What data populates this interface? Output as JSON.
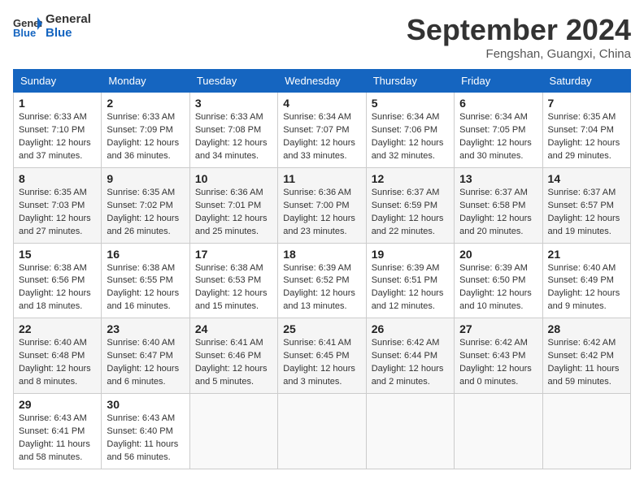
{
  "header": {
    "logo_general": "General",
    "logo_blue": "Blue",
    "month_title": "September 2024",
    "location": "Fengshan, Guangxi, China"
  },
  "weekdays": [
    "Sunday",
    "Monday",
    "Tuesday",
    "Wednesday",
    "Thursday",
    "Friday",
    "Saturday"
  ],
  "weeks": [
    [
      {
        "day": "1",
        "sunrise": "6:33 AM",
        "sunset": "7:10 PM",
        "daylight": "12 hours and 37 minutes."
      },
      {
        "day": "2",
        "sunrise": "6:33 AM",
        "sunset": "7:09 PM",
        "daylight": "12 hours and 36 minutes."
      },
      {
        "day": "3",
        "sunrise": "6:33 AM",
        "sunset": "7:08 PM",
        "daylight": "12 hours and 34 minutes."
      },
      {
        "day": "4",
        "sunrise": "6:34 AM",
        "sunset": "7:07 PM",
        "daylight": "12 hours and 33 minutes."
      },
      {
        "day": "5",
        "sunrise": "6:34 AM",
        "sunset": "7:06 PM",
        "daylight": "12 hours and 32 minutes."
      },
      {
        "day": "6",
        "sunrise": "6:34 AM",
        "sunset": "7:05 PM",
        "daylight": "12 hours and 30 minutes."
      },
      {
        "day": "7",
        "sunrise": "6:35 AM",
        "sunset": "7:04 PM",
        "daylight": "12 hours and 29 minutes."
      }
    ],
    [
      {
        "day": "8",
        "sunrise": "6:35 AM",
        "sunset": "7:03 PM",
        "daylight": "12 hours and 27 minutes."
      },
      {
        "day": "9",
        "sunrise": "6:35 AM",
        "sunset": "7:02 PM",
        "daylight": "12 hours and 26 minutes."
      },
      {
        "day": "10",
        "sunrise": "6:36 AM",
        "sunset": "7:01 PM",
        "daylight": "12 hours and 25 minutes."
      },
      {
        "day": "11",
        "sunrise": "6:36 AM",
        "sunset": "7:00 PM",
        "daylight": "12 hours and 23 minutes."
      },
      {
        "day": "12",
        "sunrise": "6:37 AM",
        "sunset": "6:59 PM",
        "daylight": "12 hours and 22 minutes."
      },
      {
        "day": "13",
        "sunrise": "6:37 AM",
        "sunset": "6:58 PM",
        "daylight": "12 hours and 20 minutes."
      },
      {
        "day": "14",
        "sunrise": "6:37 AM",
        "sunset": "6:57 PM",
        "daylight": "12 hours and 19 minutes."
      }
    ],
    [
      {
        "day": "15",
        "sunrise": "6:38 AM",
        "sunset": "6:56 PM",
        "daylight": "12 hours and 18 minutes."
      },
      {
        "day": "16",
        "sunrise": "6:38 AM",
        "sunset": "6:55 PM",
        "daylight": "12 hours and 16 minutes."
      },
      {
        "day": "17",
        "sunrise": "6:38 AM",
        "sunset": "6:53 PM",
        "daylight": "12 hours and 15 minutes."
      },
      {
        "day": "18",
        "sunrise": "6:39 AM",
        "sunset": "6:52 PM",
        "daylight": "12 hours and 13 minutes."
      },
      {
        "day": "19",
        "sunrise": "6:39 AM",
        "sunset": "6:51 PM",
        "daylight": "12 hours and 12 minutes."
      },
      {
        "day": "20",
        "sunrise": "6:39 AM",
        "sunset": "6:50 PM",
        "daylight": "12 hours and 10 minutes."
      },
      {
        "day": "21",
        "sunrise": "6:40 AM",
        "sunset": "6:49 PM",
        "daylight": "12 hours and 9 minutes."
      }
    ],
    [
      {
        "day": "22",
        "sunrise": "6:40 AM",
        "sunset": "6:48 PM",
        "daylight": "12 hours and 8 minutes."
      },
      {
        "day": "23",
        "sunrise": "6:40 AM",
        "sunset": "6:47 PM",
        "daylight": "12 hours and 6 minutes."
      },
      {
        "day": "24",
        "sunrise": "6:41 AM",
        "sunset": "6:46 PM",
        "daylight": "12 hours and 5 minutes."
      },
      {
        "day": "25",
        "sunrise": "6:41 AM",
        "sunset": "6:45 PM",
        "daylight": "12 hours and 3 minutes."
      },
      {
        "day": "26",
        "sunrise": "6:42 AM",
        "sunset": "6:44 PM",
        "daylight": "12 hours and 2 minutes."
      },
      {
        "day": "27",
        "sunrise": "6:42 AM",
        "sunset": "6:43 PM",
        "daylight": "12 hours and 0 minutes."
      },
      {
        "day": "28",
        "sunrise": "6:42 AM",
        "sunset": "6:42 PM",
        "daylight": "11 hours and 59 minutes."
      }
    ],
    [
      {
        "day": "29",
        "sunrise": "6:43 AM",
        "sunset": "6:41 PM",
        "daylight": "11 hours and 58 minutes."
      },
      {
        "day": "30",
        "sunrise": "6:43 AM",
        "sunset": "6:40 PM",
        "daylight": "11 hours and 56 minutes."
      },
      null,
      null,
      null,
      null,
      null
    ]
  ]
}
